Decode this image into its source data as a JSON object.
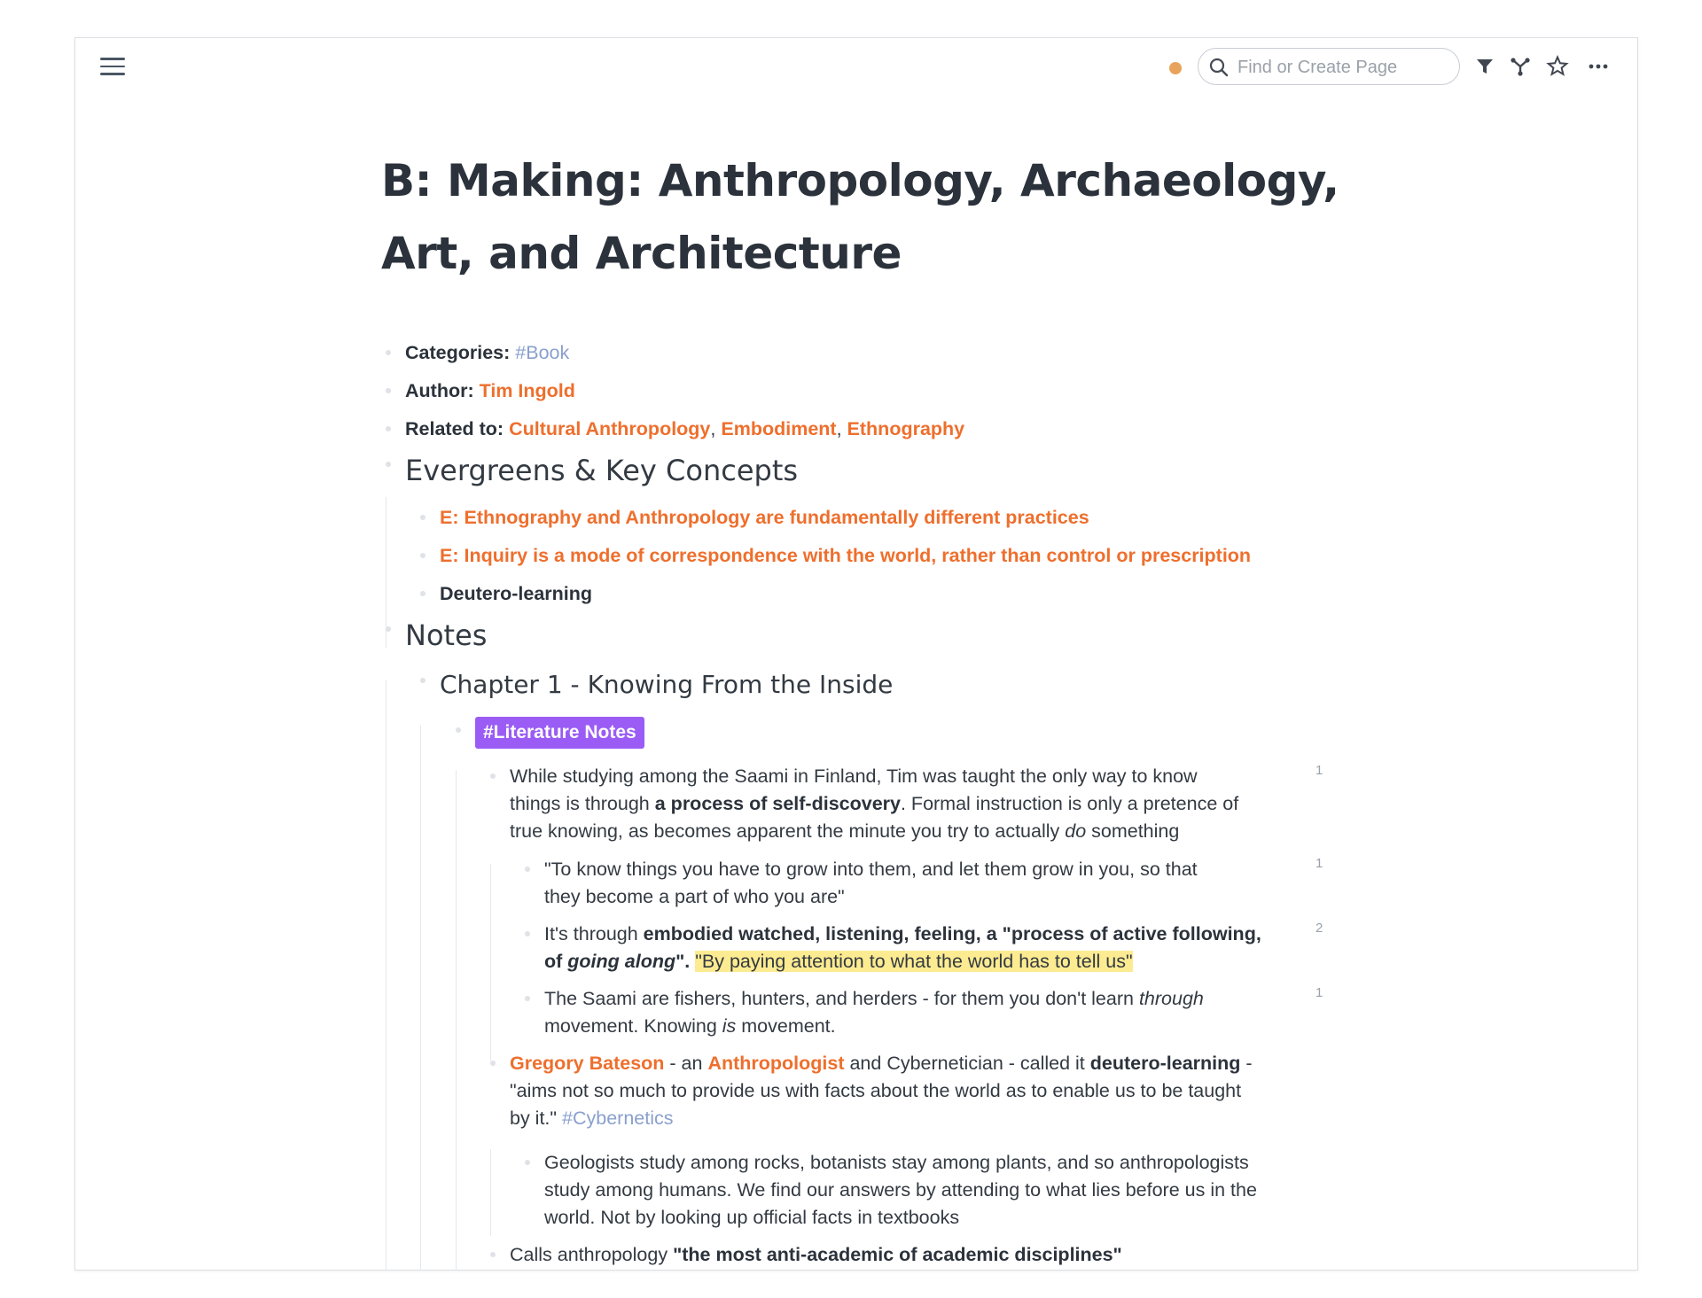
{
  "toolbar": {
    "search_placeholder": "Find or Create Page",
    "sync_color": "#e8a35c",
    "icons": [
      "menu-icon",
      "search-icon",
      "filter-icon",
      "graph-icon",
      "star-icon",
      "more-icon"
    ]
  },
  "page": {
    "title_line1": "B: Making: Anthropology, Archaeology,",
    "title_line2": "Art, and Architecture"
  },
  "attributes": {
    "categories_label": "Categories:",
    "categories_value": "#Book",
    "author_label": "Author:",
    "author_value": "Tim Ingold",
    "related_label": "Related to:",
    "related_values": [
      "Cultural Anthropology",
      "Embodiment",
      "Ethnography"
    ],
    "related_sep": ","
  },
  "evergreens": {
    "heading": "Evergreens & Key Concepts",
    "items": [
      "E: Ethnography and Anthropology are fundamentally different practices",
      "E: Inquiry is a mode of correspondence with the world, rather than control or prescription",
      "Deutero-learning"
    ]
  },
  "notes": {
    "heading": "Notes",
    "chapter": "Chapter 1 - Knowing From the Inside",
    "lit_tag": "#Literature Notes",
    "b1": {
      "l1": "While studying among the Saami in Finland, Tim was taught the only way to know",
      "l2a": "things is through ",
      "l2b": "a process of self-discovery",
      "l2c": ". Formal instruction is only a pretence of",
      "l3a": "true knowing, as becomes apparent the minute you try to actually ",
      "l3b": "do",
      "l3c": " something",
      "ref": "1"
    },
    "b1a": {
      "l1": "\"To know things you have to grow into them, and let them grow in you, so that",
      "l2": "they become a part of who you are\"",
      "ref": "1"
    },
    "b1b": {
      "l1a": "It's through ",
      "l1b": "embodied watched, listening, feeling, a \"process of active following,",
      "l2a": "of ",
      "l2b": "going along",
      "l2c": "\".",
      "l2d": "\"By paying attention to what the world has to tell us\"",
      "ref": "2"
    },
    "b1c": {
      "l1a": "The Saami are fishers, hunters, and herders - for them you don't learn ",
      "l1b": "through",
      "l2a": "movement. Knowing ",
      "l2b": "is",
      "l2c": " movement.",
      "ref": "1"
    },
    "b2": {
      "link1": "Gregory Bateson",
      "t1": " - an ",
      "link2": "Anthropologist",
      "t2": " and Cybernetician - called it ",
      "t3": "deutero-learning",
      "t4": " -",
      "l2": "\"aims not so much to provide us with facts about the world as to enable us to be taught",
      "l3a": "by it.\" ",
      "tag": "#Cybernetics"
    },
    "b2a": {
      "l1": "Geologists study among rocks, botanists stay among plants, and so anthropologists",
      "l2": "study among humans. We find our answers by attending to what lies before us in the",
      "l3": "world. Not by looking up official facts in textbooks"
    },
    "b3": {
      "t1": "Calls anthropology ",
      "t2": "\"the most anti-academic of academic disciplines\""
    }
  }
}
